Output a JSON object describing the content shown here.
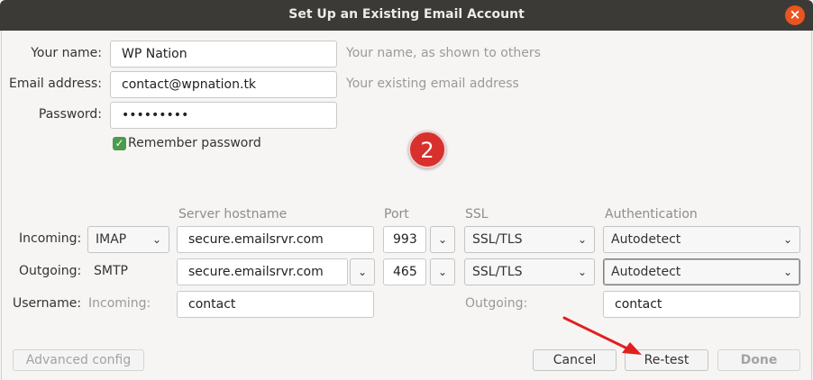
{
  "window": {
    "title": "Set Up an Existing Email Account",
    "close_glyph": "×"
  },
  "form": {
    "name_label": "Your name:",
    "name_value": "WP Nation",
    "name_hint": "Your name, as shown to others",
    "email_label": "Email address:",
    "email_value": "contact@wpnation.tk",
    "email_hint": "Your existing email address",
    "password_label": "Password:",
    "password_value": "•••••••••",
    "remember_label": "Remember password",
    "remember_checked": true
  },
  "annotation": {
    "step_number": "2",
    "color": "#d8302c"
  },
  "server": {
    "headers": {
      "hostname": "Server hostname",
      "port": "Port",
      "ssl": "SSL",
      "auth": "Authentication"
    },
    "incoming": {
      "label": "Incoming:",
      "protocol": "IMAP",
      "hostname": "secure.emailsrvr.com",
      "port": "993",
      "ssl": "SSL/TLS",
      "auth": "Autodetect"
    },
    "outgoing": {
      "label": "Outgoing:",
      "protocol": "SMTP",
      "hostname": "secure.emailsrvr.com",
      "port": "465",
      "ssl": "SSL/TLS",
      "auth": "Autodetect"
    },
    "username": {
      "label": "Username:",
      "incoming_label": "Incoming:",
      "incoming_value": "contact",
      "outgoing_label": "Outgoing:",
      "outgoing_value": "contact"
    }
  },
  "buttons": {
    "advanced": "Advanced config",
    "cancel": "Cancel",
    "retest": "Re-test",
    "done": "Done"
  },
  "icons": {
    "dropdown": "chevron-down-icon",
    "check": "checkmark-icon",
    "close": "close-icon"
  },
  "colors": {
    "titlebar": "#3b3a37",
    "close_button": "#e95420",
    "checkbox": "#4c9b4c",
    "arrow": "#e02020"
  }
}
